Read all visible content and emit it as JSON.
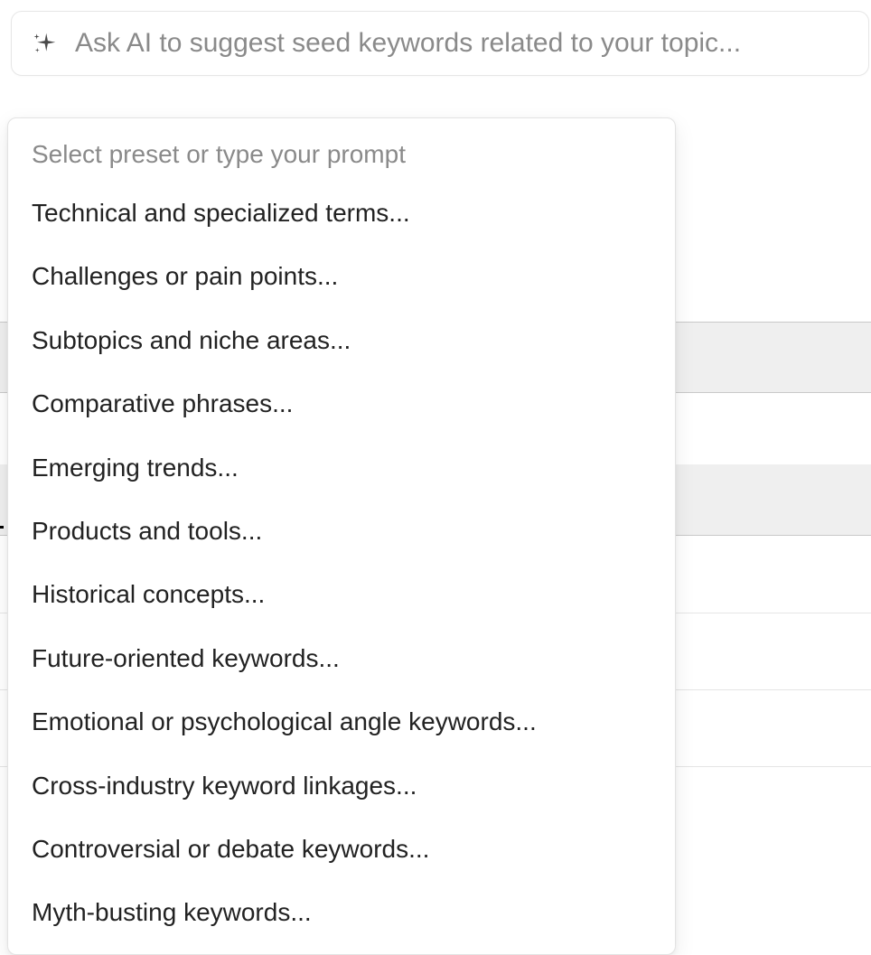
{
  "search": {
    "placeholder": "Ask AI to suggest seed keywords related to your topic..."
  },
  "dropdown": {
    "header": "Select preset or type your prompt",
    "items": [
      "Technical and specialized terms...",
      "Challenges or pain points...",
      "Subtopics and niche areas...",
      "Comparative phrases...",
      "Emerging trends...",
      "Products and tools...",
      "Historical concepts...",
      "Future-oriented keywords...",
      "Emotional or psychological angle keywords...",
      "Cross-industry keyword linkages...",
      "Controversial or debate keywords...",
      "Myth-busting keywords..."
    ]
  }
}
